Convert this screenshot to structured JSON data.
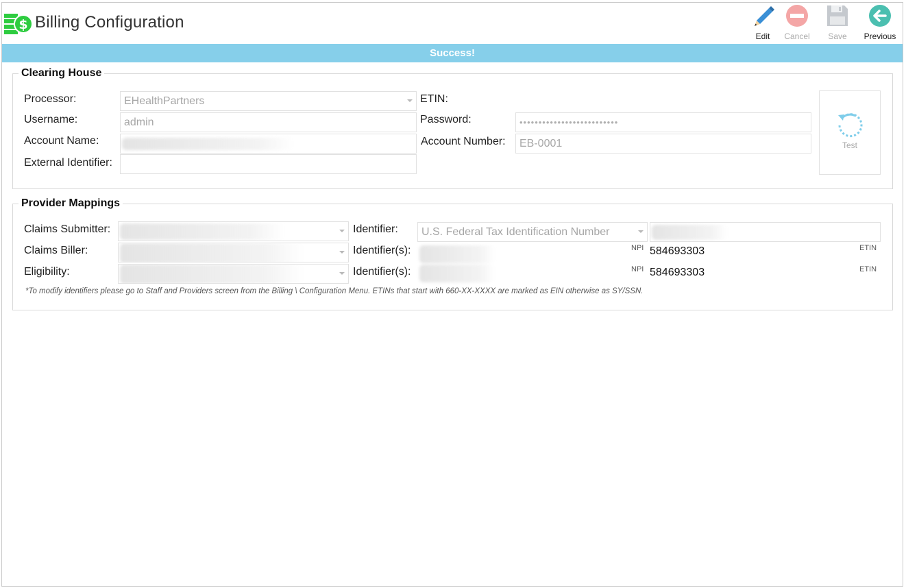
{
  "header": {
    "title": "Billing Configuration",
    "toolbar": {
      "edit": "Edit",
      "cancel": "Cancel",
      "save": "Save",
      "previous": "Previous"
    }
  },
  "banner": {
    "text": "Success!"
  },
  "clearing_house": {
    "legend": "Clearing House",
    "processor_label": "Processor:",
    "processor_value": "EHealthPartners",
    "username_label": "Username:",
    "username_value": "admin",
    "account_name_label": "Account Name:",
    "external_identifier_label": "External Identifier:",
    "external_identifier_value": "",
    "etin_label": "ETIN:",
    "password_label": "Password:",
    "password_value": "••••••••••••••••••••••••••",
    "account_number_label": "Account Number:",
    "account_number_value": "EB-0001",
    "test_label": "Test"
  },
  "provider_mappings": {
    "legend": "Provider Mappings",
    "claims_submitter_label": "Claims Submitter:",
    "claims_biller_label": "Claims Biller:",
    "eligibility_label": "Eligibility:",
    "identifier_label": "Identifier:",
    "identifier_value": "U.S. Federal Tax Identification Number",
    "identifiers_label_1": "Identifier(s):",
    "identifiers_label_2": "Identifier(s):",
    "npi_label_1": "NPI",
    "npi_value_1": "584693303",
    "etin_label_1": "ETIN",
    "npi_label_2": "NPI",
    "npi_value_2": "584693303",
    "etin_label_2": "ETIN",
    "note": "*To modify identifiers please go to Staff and Providers screen from the Billing \\ Configuration Menu. ETINs that start with 660-XX-XXXX are marked as EIN otherwise as SY/SSN."
  },
  "colors": {
    "banner": "#86cfea",
    "app_icon": "#2ecc40",
    "edit_icon": "#3a8fd6",
    "cancel_icon": "#f4a6a6",
    "previous_icon": "#4bbfb0"
  }
}
